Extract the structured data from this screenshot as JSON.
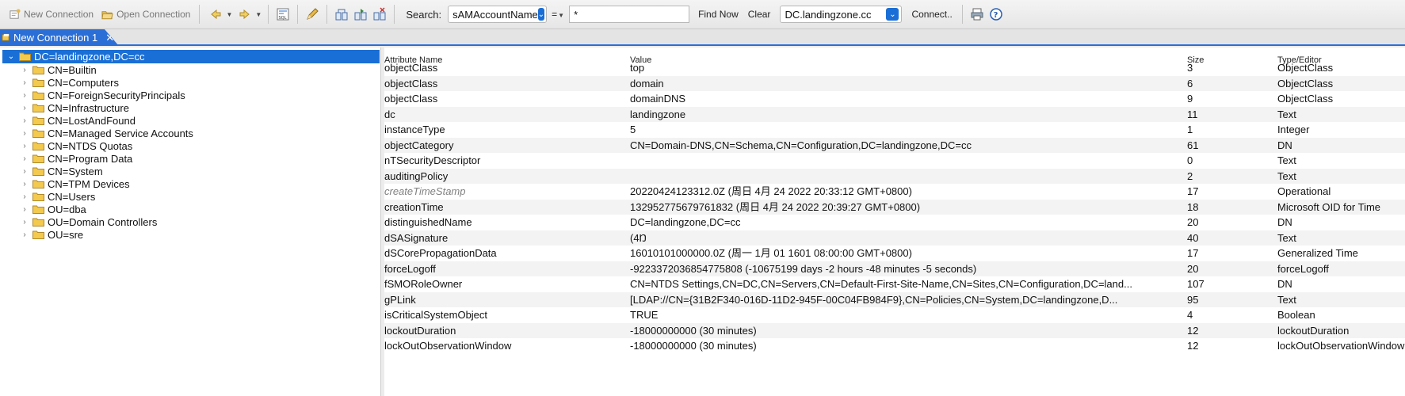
{
  "toolbar": {
    "new_connection": "New Connection",
    "open_connection": "Open Connection",
    "search_label": "Search:",
    "search_attr": "sAMAccountName",
    "operator": "=",
    "search_value": "*",
    "find_now": "Find Now",
    "clear": "Clear",
    "server": "DC.landingzone.cc",
    "connect": "Connect.."
  },
  "tab": {
    "label": "New Connection 1",
    "close": "✕"
  },
  "tree": {
    "root": "DC=landingzone,DC=cc",
    "items": [
      "CN=Builtin",
      "CN=Computers",
      "CN=ForeignSecurityPrincipals",
      "CN=Infrastructure",
      "CN=LostAndFound",
      "CN=Managed Service Accounts",
      "CN=NTDS Quotas",
      "CN=Program Data",
      "CN=System",
      "CN=TPM Devices",
      "CN=Users",
      "OU=dba",
      "OU=Domain Controllers",
      "OU=sre"
    ]
  },
  "table": {
    "headers": [
      "Attribute Name",
      "Value",
      "Size",
      "Type/Editor"
    ],
    "rows": [
      {
        "name": "objectClass",
        "value": "top",
        "size": "3",
        "type": "ObjectClass"
      },
      {
        "name": "objectClass",
        "value": "domain",
        "size": "6",
        "type": "ObjectClass"
      },
      {
        "name": "objectClass",
        "value": "domainDNS",
        "size": "9",
        "type": "ObjectClass"
      },
      {
        "name": "dc",
        "value": "landingzone",
        "size": "11",
        "type": "Text"
      },
      {
        "name": "instanceType",
        "value": "5",
        "size": "1",
        "type": "Integer"
      },
      {
        "name": "objectCategory",
        "value": "CN=Domain-DNS,CN=Schema,CN=Configuration,DC=landingzone,DC=cc",
        "size": "61",
        "type": "DN"
      },
      {
        "name": "nTSecurityDescriptor",
        "value": "",
        "size": "0",
        "type": "Text"
      },
      {
        "name": "auditingPolicy",
        "value": "",
        "size": "2",
        "type": "Text"
      },
      {
        "name": "createTimeStamp",
        "value": "20220424123312.0Z (周日 4月 24 2022 20:33:12 GMT+0800)",
        "size": "17",
        "type": "Operational",
        "operational": true
      },
      {
        "name": "creationTime",
        "value": "132952775679761832 (周日 4月 24 2022 20:39:27 GMT+0800)",
        "size": "18",
        "type": "Microsoft OID for Time"
      },
      {
        "name": "distinguishedName",
        "value": "DC=landingzone,DC=cc",
        "size": "20",
        "type": "DN"
      },
      {
        "name": "dSASignature",
        "value": "(4Ŋ",
        "size": "40",
        "type": "Text"
      },
      {
        "name": "dSCorePropagationData",
        "value": "16010101000000.0Z (周一 1月 01 1601 08:00:00 GMT+0800)",
        "size": "17",
        "type": "Generalized Time"
      },
      {
        "name": "forceLogoff",
        "value": "-9223372036854775808 (-10675199 days -2 hours -48 minutes -5 seconds)",
        "size": "20",
        "type": "forceLogoff"
      },
      {
        "name": "fSMORoleOwner",
        "value": "CN=NTDS Settings,CN=DC,CN=Servers,CN=Default-First-Site-Name,CN=Sites,CN=Configuration,DC=land...",
        "size": "107",
        "type": "DN"
      },
      {
        "name": "gPLink",
        "value": "[LDAP://CN={31B2F340-016D-11D2-945F-00C04FB984F9},CN=Policies,CN=System,DC=landingzone,D...",
        "size": "95",
        "type": "Text"
      },
      {
        "name": "isCriticalSystemObject",
        "value": "TRUE",
        "size": "4",
        "type": "Boolean"
      },
      {
        "name": "lockoutDuration",
        "value": "-18000000000 (30 minutes)",
        "size": "12",
        "type": "lockoutDuration"
      },
      {
        "name": "lockOutObservationWindow",
        "value": "-18000000000 (30 minutes)",
        "size": "12",
        "type": "lockOutObservationWindow"
      }
    ]
  }
}
